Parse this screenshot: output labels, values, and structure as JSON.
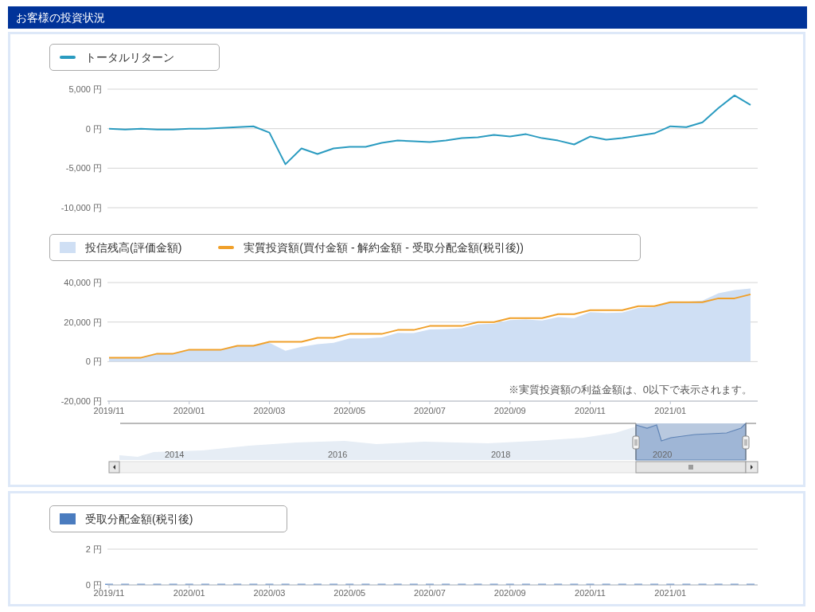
{
  "header": {
    "title": "お客様の投資状況"
  },
  "panels": [
    {
      "charts": [
        {
          "chart_data": {
            "type": "line",
            "ylim": [
              -10000,
              5000
            ],
            "yticks": [
              {
                "value": 5000,
                "label": "5,000 円"
              },
              {
                "value": 0,
                "label": "0 円"
              },
              {
                "value": -5000,
                "label": "-5,000 円"
              },
              {
                "value": -10000,
                "label": "-10,000 円"
              }
            ],
            "series": [
              {
                "name": "トータルリターン",
                "color": "#2a9bc0",
                "values": [
                  0,
                  -100,
                  0,
                  -100,
                  -100,
                  0,
                  0,
                  100,
                  200,
                  300,
                  -500,
                  -4500,
                  -2500,
                  -3200,
                  -2500,
                  -2300,
                  -2300,
                  -1800,
                  -1500,
                  -1600,
                  -1700,
                  -1500,
                  -1200,
                  -1100,
                  -800,
                  -1000,
                  -700,
                  -1200,
                  -1500,
                  -2000,
                  -1000,
                  -1400,
                  -1200,
                  -900,
                  -600,
                  300,
                  200,
                  800,
                  2600,
                  4200,
                  3000
                ]
              }
            ]
          }
        },
        {
          "note": "※実質投資額の利益金額は、0以下で表示されます。",
          "chart_data": {
            "type": "area",
            "ylim": [
              -20000,
              40000
            ],
            "categories": [
              "2019/11",
              null,
              null,
              null,
              null,
              "2020/01",
              null,
              null,
              null,
              null,
              "2020/03",
              null,
              null,
              null,
              null,
              "2020/05",
              null,
              null,
              null,
              null,
              "2020/07",
              null,
              null,
              null,
              null,
              "2020/09",
              null,
              null,
              null,
              null,
              "2020/11",
              null,
              null,
              null,
              null,
              "2021/01",
              null,
              null,
              null,
              null,
              null
            ],
            "yticks": [
              {
                "value": 40000,
                "label": "40,000 円"
              },
              {
                "value": 20000,
                "label": "20,000 円"
              },
              {
                "value": 0,
                "label": "0 円"
              },
              {
                "value": -20000,
                "label": "-20,000 円"
              }
            ],
            "series": [
              {
                "name": "投信残高(評価金額)",
                "color": "#cfdff4",
                "values": [
                  2000,
                  1900,
                  2000,
                  3900,
                  3900,
                  6000,
                  6000,
                  6100,
                  8200,
                  8300,
                  9500,
                  5500,
                  7500,
                  8800,
                  9500,
                  11700,
                  11700,
                  12200,
                  14500,
                  14400,
                  16300,
                  16500,
                  16800,
                  18900,
                  19200,
                  21000,
                  21300,
                  20800,
                  22500,
                  22000,
                  25000,
                  24600,
                  24800,
                  27100,
                  27400,
                  30300,
                  30200,
                  30800,
                  34600,
                  36200,
                  37000
                ]
              },
              {
                "name": "実質投資額(買付金額 - 解約金額 - 受取分配金額(税引後))",
                "type": "line",
                "color": "#f0a02a",
                "values": [
                  2000,
                  2000,
                  2000,
                  4000,
                  4000,
                  6000,
                  6000,
                  6000,
                  8000,
                  8000,
                  10000,
                  10000,
                  10000,
                  12000,
                  12000,
                  14000,
                  14000,
                  14000,
                  16000,
                  16000,
                  18000,
                  18000,
                  18000,
                  20000,
                  20000,
                  22000,
                  22000,
                  22000,
                  24000,
                  24000,
                  26000,
                  26000,
                  26000,
                  28000,
                  28000,
                  30000,
                  30000,
                  30000,
                  32000,
                  32000,
                  34000
                ]
              }
            ]
          },
          "navigator": {
            "year_labels": [
              "2014",
              "2016",
              "2018",
              "2020"
            ]
          }
        }
      ]
    },
    {
      "charts": [
        {
          "chart_data": {
            "type": "bar",
            "ylim": [
              0,
              2
            ],
            "categories": [
              "2019/11",
              null,
              null,
              null,
              null,
              "2020/01",
              null,
              null,
              null,
              null,
              "2020/03",
              null,
              null,
              null,
              null,
              "2020/05",
              null,
              null,
              null,
              null,
              "2020/07",
              null,
              null,
              null,
              null,
              "2020/09",
              null,
              null,
              null,
              null,
              "2020/11",
              null,
              null,
              null,
              null,
              "2021/01",
              null,
              null,
              null,
              null,
              null
            ],
            "yticks": [
              {
                "value": 2,
                "label": "2 円"
              },
              {
                "value": 0,
                "label": "0 円"
              }
            ],
            "series": [
              {
                "name": "受取分配金額(税引後)",
                "color": "#4a7cbf",
                "values": [
                  0,
                  0,
                  0,
                  0,
                  0,
                  0,
                  0,
                  0,
                  0,
                  0,
                  0,
                  0,
                  0,
                  0,
                  0,
                  0,
                  0,
                  0,
                  0,
                  0,
                  0,
                  0,
                  0,
                  0,
                  0,
                  0,
                  0,
                  0,
                  0,
                  0,
                  0,
                  0,
                  0,
                  0,
                  0,
                  0,
                  0,
                  0,
                  0,
                  0,
                  0
                ]
              }
            ]
          }
        }
      ]
    }
  ]
}
